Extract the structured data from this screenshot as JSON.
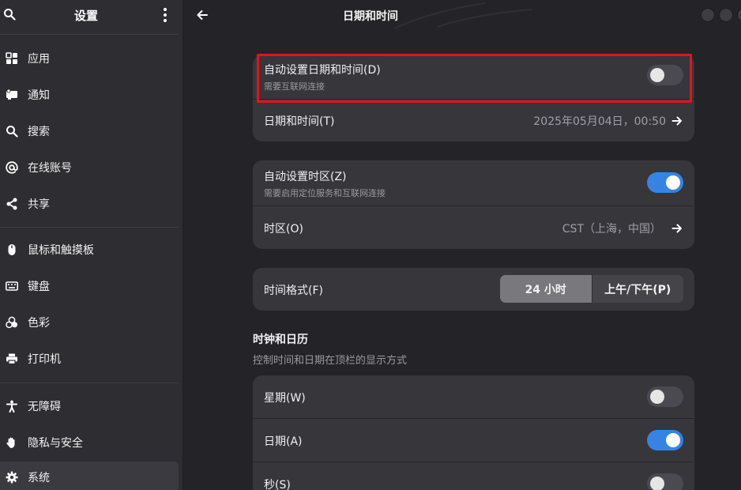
{
  "sidebar": {
    "title": "设置",
    "items": [
      {
        "label": "应用"
      },
      {
        "label": "通知"
      },
      {
        "label": "搜索"
      },
      {
        "label": "在线账号"
      },
      {
        "label": "共享"
      },
      {
        "label": "鼠标和触摸板"
      },
      {
        "label": "键盘"
      },
      {
        "label": "色彩"
      },
      {
        "label": "打印机"
      },
      {
        "label": "无障碍"
      },
      {
        "label": "隐私与安全"
      },
      {
        "label": "系统"
      }
    ],
    "active_item": "系统"
  },
  "header": {
    "title": "日期和时间"
  },
  "datetime_group": {
    "auto_datetime": {
      "title": "自动设置日期和时间(D)",
      "subtitle": "需要互联网连接",
      "enabled": false
    },
    "datetime": {
      "title": "日期和时间(T)",
      "value": "2025年05月04日，00:50"
    }
  },
  "timezone_group": {
    "auto_timezone": {
      "title": "自动设置时区(Z)",
      "subtitle": "需要启用定位服务和互联网连接",
      "enabled": true
    },
    "timezone": {
      "title": "时区(O)",
      "value": "CST（上海，中国）"
    }
  },
  "format_group": {
    "title": "时间格式(F)",
    "options": [
      "24 小时",
      "上午/下午(P)"
    ],
    "selected": "24 小时"
  },
  "clock_section": {
    "title": "时钟和日历",
    "subtitle": "控制时间和日期在顶栏的显示方式",
    "weekday": {
      "title": "星期(W)",
      "enabled": false
    },
    "date": {
      "title": "日期(A)",
      "enabled": true
    },
    "seconds": {
      "title": "秒(S)",
      "enabled": false
    }
  },
  "colors": {
    "accent": "#3584e4",
    "highlight": "#e0151c"
  }
}
